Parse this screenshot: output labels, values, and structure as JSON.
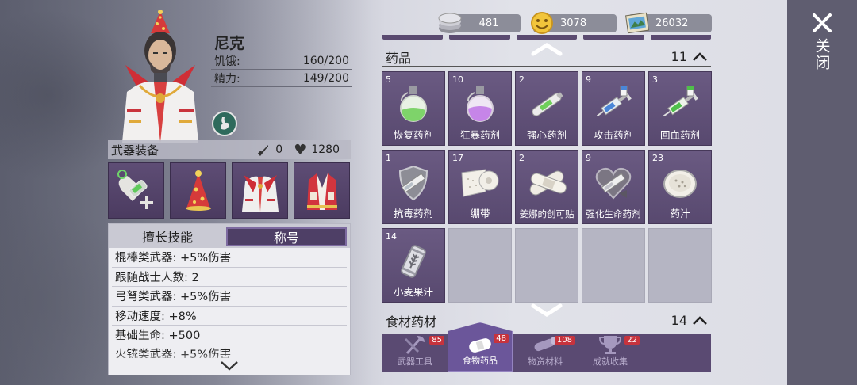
{
  "character": {
    "name": "尼克",
    "stats": [
      {
        "label": "饥饿:",
        "value": "160/200"
      },
      {
        "label": "精力:",
        "value": "149/200"
      }
    ]
  },
  "equipment": {
    "title": "武器装备",
    "attack": "0",
    "health": "1280",
    "slots": [
      "heal-syringe",
      "party-hat",
      "white-jacket",
      "red-vest"
    ]
  },
  "skills": {
    "tabs": [
      {
        "label": "擅长技能",
        "active": false
      },
      {
        "label": "称号",
        "active": true
      }
    ],
    "items": [
      "棍棒类武器: +5%伤害",
      "跟随战士人数: 2",
      "弓弩类武器: +5%伤害",
      "移动速度: +8%",
      "基础生命: +500",
      "火铳类武器: +5%伤害"
    ]
  },
  "currency": [
    {
      "icon": "coin-stack-icon",
      "value": "481"
    },
    {
      "icon": "smiley-coin-icon",
      "value": "3078"
    },
    {
      "icon": "photo-ticket-icon",
      "value": "26032"
    }
  ],
  "inventory": {
    "section1": {
      "title": "药品",
      "count": "11"
    },
    "section2": {
      "title": "食材药材",
      "count": "14"
    },
    "items": [
      {
        "qty": "5",
        "label": "恢复药剂",
        "icon": "green-potion-icon",
        "color": "#7ed36a"
      },
      {
        "qty": "10",
        "label": "狂暴药剂",
        "icon": "purple-potion-icon",
        "color": "#c685e8"
      },
      {
        "qty": "2",
        "label": "强心药剂",
        "icon": "green-pen-injector-icon",
        "color": "#6fcf5a"
      },
      {
        "qty": "9",
        "label": "攻击药剂",
        "icon": "blue-syringe-icon",
        "color": "#4a86d8"
      },
      {
        "qty": "3",
        "label": "回血药剂",
        "icon": "green-syringe-icon",
        "color": "#4fbf4a"
      },
      {
        "qty": "1",
        "label": "抗毒药剂",
        "icon": "shield-syringe-icon",
        "color": "#c9c9cf"
      },
      {
        "qty": "17",
        "label": "绷带",
        "icon": "bandage-roll-icon",
        "color": "#e8e6df"
      },
      {
        "qty": "2",
        "label": "姜娜的创可贴",
        "icon": "adhesive-bandage-icon",
        "color": "#e8e6df"
      },
      {
        "qty": "9",
        "label": "强化生命药剂",
        "icon": "heart-syringe-icon",
        "color": "#cfcfd6"
      },
      {
        "qty": "23",
        "label": "药汁",
        "icon": "herb-bowl-icon",
        "color": "#e8e6df"
      },
      {
        "qty": "14",
        "label": "小麦果汁",
        "icon": "wheat-can-icon",
        "color": "#d8d8de"
      }
    ],
    "empty_cells": 4
  },
  "tabs": [
    {
      "label": "武器工具",
      "badge": "85",
      "icon": "axe-tools-icon",
      "active": false
    },
    {
      "label": "食物药品",
      "badge": "48",
      "icon": "food-medicine-icon",
      "active": true
    },
    {
      "label": "物资材料",
      "badge": "108",
      "icon": "log-materials-icon",
      "active": false
    },
    {
      "label": "成就收集",
      "badge": "22",
      "icon": "trophy-icon",
      "active": false
    }
  ],
  "close": {
    "label": "关闭"
  }
}
